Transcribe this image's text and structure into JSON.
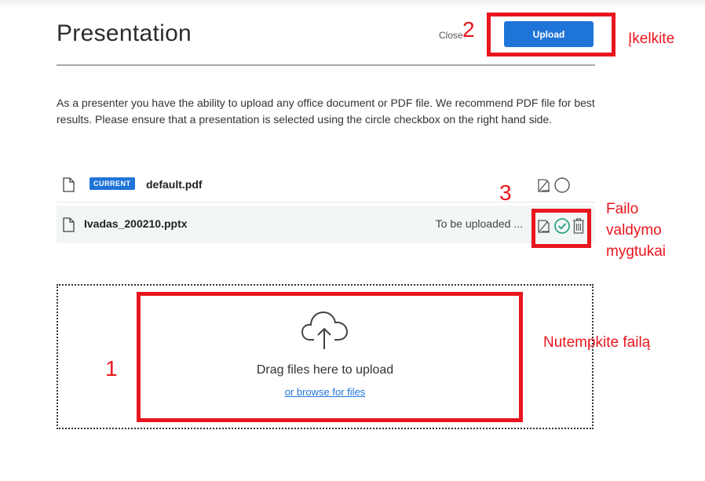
{
  "dialog": {
    "title": "Presentation",
    "close_label": "Close",
    "upload_label": "Upload",
    "description": "As a presenter you have the ability to upload any office document or PDF file. We recommend PDF file for best results. Please ensure that a presentation is selected using the circle checkbox on the right hand side."
  },
  "files": [
    {
      "badge": "CURRENT",
      "name": "default.pdf",
      "status": ""
    },
    {
      "badge": "",
      "name": "Ivadas_200210.pptx",
      "status": "To be uploaded ..."
    }
  ],
  "dropzone": {
    "text": "Drag files here to upload",
    "browse_label": "or browse for files",
    "icon": "cloud-upload-icon"
  },
  "annotations": {
    "upload_num": "2",
    "upload_text": "Įkelkite",
    "controls_num": "3",
    "controls_text_1": "Failo",
    "controls_text_2": "valdymo",
    "controls_text_3": "mygtukai",
    "drop_num": "1",
    "drop_text": "Nutempkite failą"
  },
  "colors": {
    "accent": "#1f74d8",
    "annotation": "#e8161e",
    "check": "#1a9b7a"
  }
}
